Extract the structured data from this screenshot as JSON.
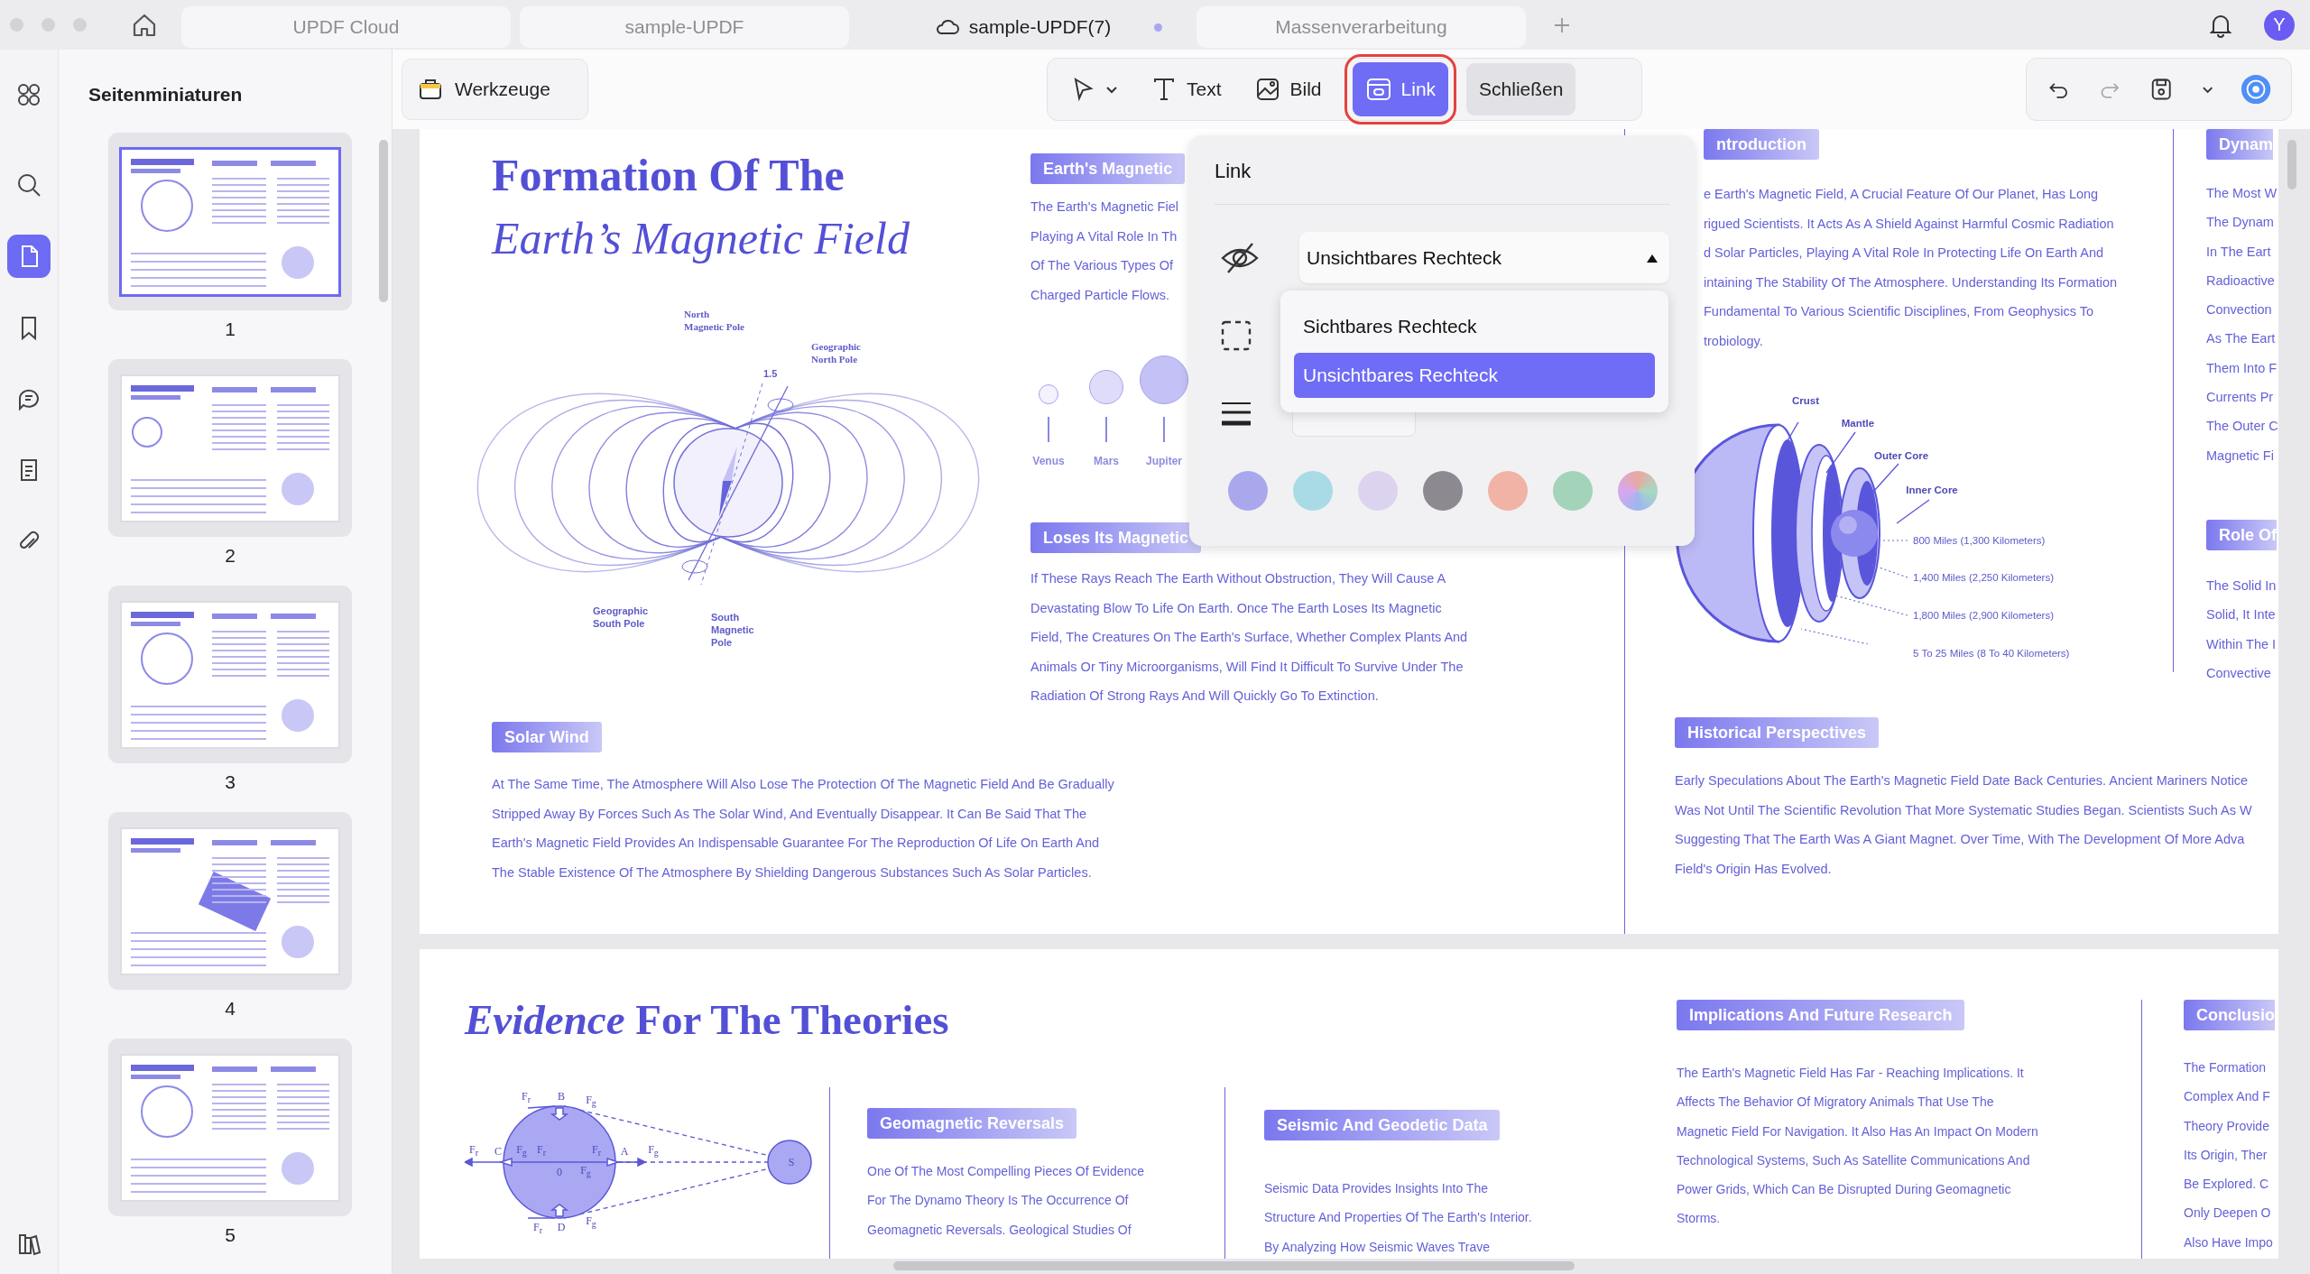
{
  "tabs": [
    {
      "label": "UPDF Cloud",
      "selected": false,
      "cloud": false,
      "modified": false
    },
    {
      "label": "sample-UPDF",
      "selected": false,
      "cloud": false,
      "modified": false
    },
    {
      "label": "sample-UPDF(7)",
      "selected": true,
      "cloud": true,
      "modified": true
    },
    {
      "label": "Massenverarbeitung",
      "selected": false,
      "cloud": false,
      "modified": false
    }
  ],
  "user": {
    "initial": "Y"
  },
  "rail": [
    {
      "kind": "grid",
      "selected": false
    },
    {
      "kind": "search",
      "selected": false
    },
    {
      "kind": "pages",
      "selected": true
    },
    {
      "kind": "bookmark",
      "selected": false
    },
    {
      "kind": "comment",
      "selected": false
    },
    {
      "kind": "form",
      "selected": false
    },
    {
      "kind": "attachment",
      "selected": false
    }
  ],
  "sidebar": {
    "title": "Seitenminiaturen",
    "thumbnails": [
      {
        "label": "1",
        "selected": true
      },
      {
        "label": "2",
        "selected": false
      },
      {
        "label": "3",
        "selected": false
      },
      {
        "label": "4",
        "selected": false
      },
      {
        "label": "5",
        "selected": false
      }
    ]
  },
  "toolbar": {
    "tools_button": "Werkzeuge",
    "modes": [
      {
        "kind": "select",
        "selected": false
      },
      {
        "kind": "text",
        "label": "Text",
        "selected": false
      },
      {
        "kind": "image",
        "label": "Bild",
        "selected": false
      },
      {
        "kind": "link",
        "label": "Link",
        "selected": true
      }
    ],
    "close": "Schließen"
  },
  "link_panel": {
    "title": "Link",
    "style": {
      "value": "Unsichtbares Rechteck",
      "expanded": true
    },
    "options": [
      {
        "label": "Sichtbares Rechteck",
        "selected": false
      },
      {
        "label": "Unsichtbares Rechteck",
        "selected": true
      }
    ],
    "colors": [
      {
        "kind": "solid",
        "color": "#a9a8ec"
      },
      {
        "kind": "solid",
        "color": "#a8dbe6"
      },
      {
        "kind": "solid",
        "color": "#dcd3ef"
      },
      {
        "kind": "solid",
        "color": "#8c8a90"
      },
      {
        "kind": "solid",
        "color": "#f0b3a6"
      },
      {
        "kind": "solid",
        "color": "#a3d3b8"
      },
      {
        "kind": "gradient"
      }
    ]
  },
  "document": {
    "page1": {
      "title": "Formation Of The",
      "subtitle": "Earth’s Magnetic Field",
      "field_diagram": {
        "labels": [
          "North Magnetic Pole",
          "Geographic North Pole",
          "1.5",
          "Geographic South Pole",
          "South Magnetic Pole"
        ]
      },
      "magnetic": {
        "heading": "Earth's Magnetic",
        "lines": [
          "The Earth's Magnetic Fiel",
          "Playing A Vital Role In Th",
          "Of The Various Types Of",
          "Charged Particle Flows."
        ]
      },
      "planets": [
        {
          "name": "Venus"
        },
        {
          "name": "Mars"
        },
        {
          "name": "Jupiter"
        }
      ],
      "loses": {
        "heading": "Loses Its Magnetic",
        "lines": [
          "If These Rays Reach The Earth Without Obstruction, They Will Cause A",
          "Devastating Blow To Life On Earth. Once The Earth Loses Its Magnetic",
          "Field, The Creatures On The Earth's Surface, Whether Complex Plants And",
          "Animals Or Tiny Microorganisms, Will Find It Difficult To Survive Under The",
          "Radiation Of Strong Rays And Will Quickly Go To Extinction."
        ]
      },
      "solar_wind": {
        "heading": "Solar Wind",
        "lines": [
          "At The Same Time, The Atmosphere Will Also Lose The Protection Of The Magnetic Field And Be Gradually",
          "Stripped Away By Forces Such As The Solar Wind, And Eventually Disappear. It Can Be Said That The",
          "Earth's Magnetic Field Provides An Indispensable Guarantee For The Reproduction Of Life On Earth And",
          "The Stable Existence Of The Atmosphere By Shielding Dangerous Substances Such As Solar Particles."
        ]
      },
      "introduction": {
        "heading": "ntroduction",
        "lines": [
          "e Earth's Magnetic Field, A Crucial Feature Of Our Planet, Has Long",
          "rigued Scientists. It Acts As A Shield Against Harmful Cosmic Radiation",
          "d Solar Particles, Playing A Vital Role In Protecting Life On Earth And",
          "intaining The Stability Of The Atmosphere. Understanding Its Formation",
          "Fundamental To Various Scientific Disciplines, From Geophysics To",
          "trobiology."
        ]
      },
      "layers_diagram": {
        "labels": [
          "Crust",
          "Mantle",
          "Outer Core",
          "Inner Core",
          "800 Miles (1,300 Kilometers)",
          "1,400 Miles (2,250 Kilometers)",
          "1,800 Miles (2,900 Kilometers)",
          "5 To 25 Miles (8 To 40 Kilometers)"
        ]
      },
      "historical": {
        "heading": "Historical Perspectives",
        "lines": [
          "Early Speculations About The Earth's Magnetic Field Date Back Centuries. Ancient Mariners Notice",
          "Was Not Until The Scientific Revolution That More Systematic Studies Began. Scientists Such As W",
          "Suggesting That The Earth Was A Giant Magnet. Over Time, With The Development Of More Adva",
          "Field's Origin Has Evolved."
        ]
      },
      "dynamo": {
        "heading": "Dynam",
        "lines": [
          "The Most W",
          "The Dynam",
          "In The Eart",
          "Radioactive",
          "Convection",
          "As The Eart",
          "Them Into F",
          "Currents Pr",
          "The Outer C",
          "Magnetic Fi"
        ]
      },
      "role": {
        "heading": "Role Of",
        "lines": [
          "The Solid In",
          "Solid, It Inte",
          "Within The I",
          "Convective"
        ]
      }
    },
    "page2": {
      "title": "*Evidence* For The Theories",
      "force_diagram": {
        "labels": [
          "F$_{r}$",
          "B",
          "F$_{g}$",
          "F$_{r}$",
          "C",
          "F$_{g}$",
          "F$_{r}$",
          "F$_{r}$",
          "A",
          "F$_{g}$",
          "0",
          "F$_{g}$",
          "F$_{r}$",
          "D",
          "F$_{g}$",
          "S"
        ]
      },
      "geomagnetic": {
        "heading": "Geomagnetic Reversals",
        "lines": [
          "One Of The Most Compelling Pieces Of Evidence",
          "For The Dynamo Theory Is The Occurrence Of",
          "Geomagnetic Reversals. Geological Studies Of"
        ]
      },
      "seismic": {
        "heading": "Seismic And Geodetic Data",
        "lines": [
          "Seismic Data Provides Insights Into The",
          "Structure And Properties Of The Earth's Interior.",
          "By Analyzing How Seismic Waves Trave"
        ]
      },
      "implications": {
        "heading": "Implications And Future Research",
        "lines": [
          "The Earth's Magnetic Field Has Far - Reaching Implications. It",
          "Affects The Behavior Of Migratory Animals That Use The",
          "Magnetic Field For Navigation. It Also Has An Impact On Modern",
          "Technological Systems, Such As Satellite Communications And",
          "Power Grids, Which Can Be Disrupted During Geomagnetic",
          "Storms."
        ]
      },
      "conclusion": {
        "heading": "Conclusio",
        "lines": [
          "The Formation",
          "Complex And F",
          "Theory Provide",
          "Its Origin, Ther",
          "Be Explored. C",
          "Only Deepen O",
          "Also Have Impo"
        ]
      }
    }
  }
}
